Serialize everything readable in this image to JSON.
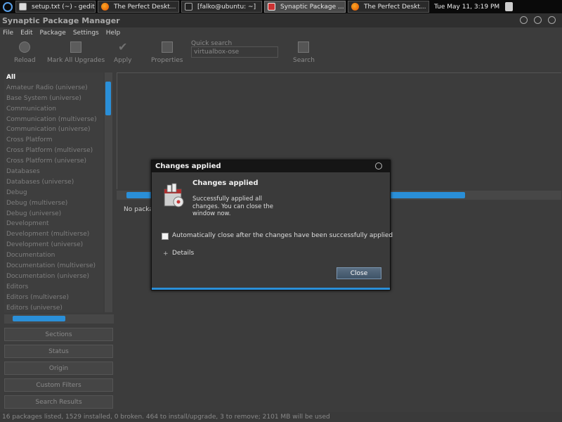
{
  "taskbar": {
    "tasks": [
      {
        "label": "setup.txt (~) - gedit",
        "icon": "gedit-icon"
      },
      {
        "label": "The Perfect Deskt...",
        "icon": "firefox-icon"
      },
      {
        "label": "[falko@ubuntu: ~]",
        "icon": "terminal-icon"
      },
      {
        "label": "Synaptic Package ...",
        "icon": "synaptic-icon"
      },
      {
        "label": "The Perfect Deskt...",
        "icon": "firefox-icon"
      }
    ],
    "clock": "Tue May 11,  3:19 PM"
  },
  "window": {
    "title": "Synaptic Package Manager"
  },
  "menu": [
    "File",
    "Edit",
    "Package",
    "Settings",
    "Help"
  ],
  "toolbar": {
    "reload": "Reload",
    "mark_all": "Mark All Upgrades",
    "apply": "Apply",
    "properties": "Properties",
    "quick_search_label": "Quick search",
    "quick_search_value": "virtualbox-ose",
    "search": "Search"
  },
  "categories": [
    "All",
    "Amateur Radio (universe)",
    "Base System (universe)",
    "Communication",
    "Communication (multiverse)",
    "Communication (universe)",
    "Cross Platform",
    "Cross Platform (multiverse)",
    "Cross Platform (universe)",
    "Databases",
    "Databases (universe)",
    "Debug",
    "Debug (multiverse)",
    "Debug (universe)",
    "Development",
    "Development (multiverse)",
    "Development (universe)",
    "Documentation",
    "Documentation (multiverse)",
    "Documentation (universe)",
    "Editors",
    "Editors (multiverse)",
    "Editors (universe)"
  ],
  "side_buttons": {
    "sections": "Sections",
    "status": "Status",
    "origin": "Origin",
    "custom_filters": "Custom Filters",
    "search_results": "Search Results"
  },
  "main": {
    "no_package": "No packa"
  },
  "status": "16 packages listed, 1529 installed, 0 broken. 464 to install/upgrade, 3 to remove; 2101 MB will be used",
  "dialog": {
    "title": "Changes applied",
    "heading": "Changes applied",
    "message": "Successfully applied all changes. You can close the window now.",
    "auto_close_label": "Automatically close after the changes have been successfully applied",
    "details_label": "Details",
    "close_button": "Close"
  }
}
